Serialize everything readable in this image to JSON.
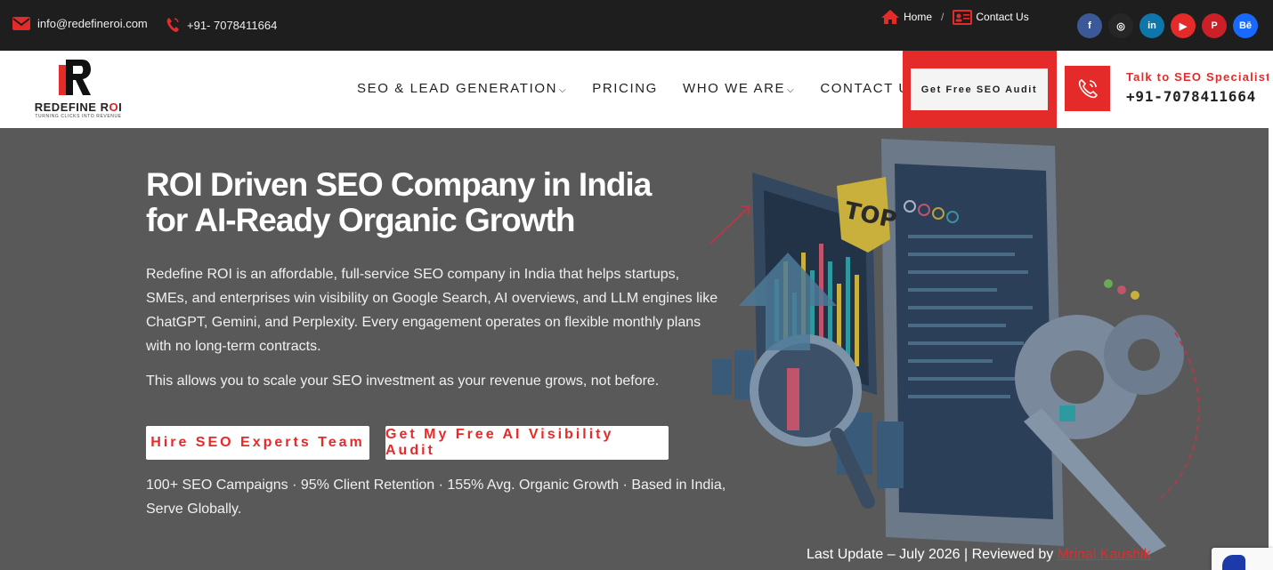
{
  "topbar": {
    "email": "info@redefineroi.com",
    "phone": "+91- 7078411664",
    "breadcrumb": {
      "home": "Home",
      "separator": "/",
      "contact": "Contact Us"
    },
    "socials": [
      {
        "name": "facebook",
        "glyph": "f",
        "color": "#3b5998"
      },
      {
        "name": "instagram",
        "glyph": "◎",
        "color": "#262626"
      },
      {
        "name": "linkedin",
        "glyph": "in",
        "color": "#0e76a8"
      },
      {
        "name": "youtube",
        "glyph": "▶",
        "color": "#e52a2a"
      },
      {
        "name": "pinterest",
        "glyph": "P",
        "color": "#cb2027"
      },
      {
        "name": "behance",
        "glyph": "Bē",
        "color": "#1769ff"
      }
    ]
  },
  "header": {
    "logo": {
      "brand_pre": "REDEFINE R",
      "brand_o": "O",
      "brand_post": "I",
      "tagline": "TURNING CLICKS INTO REVENUE"
    },
    "nav": {
      "seo": "SEO & LEAD GENERATION",
      "pricing": "PRICING",
      "who": "WHO WE ARE",
      "contact": "CONTACT US"
    },
    "cta": "Get Free SEO Audit",
    "talk_label": "Talk to SEO Specialist",
    "talk_phone": "+91-7078411664"
  },
  "hero": {
    "title": "ROI Driven SEO Company in India for AI-Ready Organic Growth",
    "description": "Redefine ROI is an affordable, full-service SEO company in India that helps startups, SMEs, and enterprises win visibility on Google Search, AI overviews, and LLM engines like ChatGPT, Gemini, and Perplexity. Every engagement operates on flexible monthly plans with no long-term contracts.",
    "note": "This allows you to scale your SEO investment as your revenue grows, not before.",
    "btn_hire": "Hire SEO Experts Team",
    "btn_audit": "Get My Free AI Visibility Audit",
    "stats": "100+ SEO Campaigns · 95% Client Retention · 155% Avg. Organic Growth · Based in India, Serve Globally.",
    "last_update_prefix": "Last Update – July 2026 | Reviewed by ",
    "reviewer": "Mrinal Kaushik",
    "illustration_text": "TOP"
  },
  "colors": {
    "accent": "#e52a2a",
    "topbar": "#1e1e1e",
    "hero_bg": "#595959"
  }
}
